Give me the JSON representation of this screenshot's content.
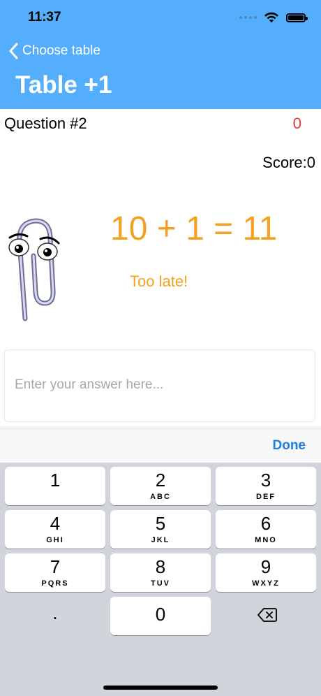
{
  "status_bar": {
    "time": "11:37"
  },
  "nav": {
    "back_label": "Choose table",
    "title": "Table +1"
  },
  "quiz": {
    "question_label": "Question #2",
    "timer": "0",
    "score": "Score:0",
    "equation": "10 + 1 = 11",
    "feedback": "Too late!"
  },
  "answer": {
    "placeholder": "Enter your answer here..."
  },
  "toolbar": {
    "done_label": "Done"
  },
  "keypad": {
    "keys": [
      {
        "num": "1",
        "letters": ""
      },
      {
        "num": "2",
        "letters": "ABC"
      },
      {
        "num": "3",
        "letters": "DEF"
      },
      {
        "num": "4",
        "letters": "GHI"
      },
      {
        "num": "5",
        "letters": "JKL"
      },
      {
        "num": "6",
        "letters": "MNO"
      },
      {
        "num": "7",
        "letters": "PQRS"
      },
      {
        "num": "8",
        "letters": "TUV"
      },
      {
        "num": "9",
        "letters": "WXYZ"
      },
      {
        "num": ".",
        "letters": ""
      },
      {
        "num": "0",
        "letters": ""
      }
    ],
    "delete_icon": "backspace-icon"
  },
  "colors": {
    "header": "#54aefc",
    "accent_orange": "#f3a21f",
    "timer_red": "#e53935",
    "done_blue": "#1d7fe0"
  }
}
